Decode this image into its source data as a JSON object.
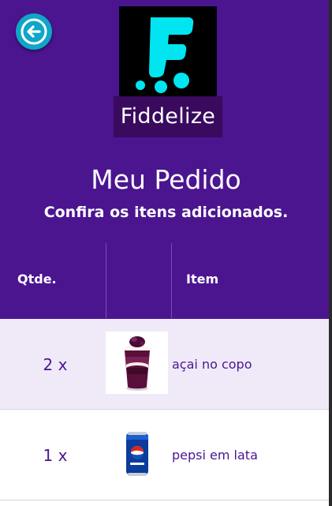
{
  "header": {
    "brand_name": "Fiddelize",
    "logo_letter": "F",
    "title": "Meu Pedido",
    "subtitle": "Confira os itens adicionados."
  },
  "table": {
    "columns": [
      "Qtde.",
      "",
      "Item"
    ],
    "rows": [
      {
        "qty": "2 x",
        "item": "açai no copo",
        "icon": "acai-cup-image"
      },
      {
        "qty": "1 x",
        "item": "pepsi em lata",
        "icon": "pepsi-can-image"
      }
    ]
  },
  "colors": {
    "primary": "#4b1590",
    "accent": "#0fa6c8",
    "logo_mark": "#00e5f0"
  }
}
